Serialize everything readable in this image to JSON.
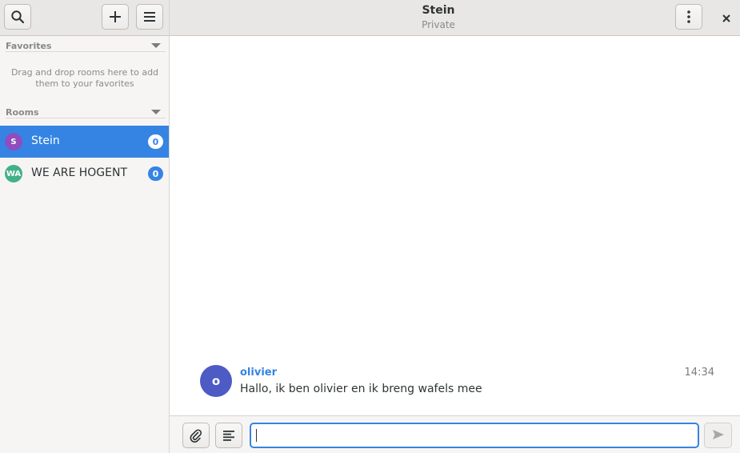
{
  "sidebar": {
    "favorites": {
      "label": "Favorites",
      "hint": "Drag and drop rooms here to add them to your favorites"
    },
    "rooms_section": {
      "label": "Rooms"
    },
    "rooms": [
      {
        "initials": "S",
        "name": "Stein",
        "count": "0",
        "avatar_color": "#8f4dc0",
        "selected": true
      },
      {
        "initials": "WA",
        "name": "WE ARE HOGENT",
        "count": "0",
        "avatar_color": "#43b089",
        "selected": false
      }
    ]
  },
  "header": {
    "title": "Stein",
    "subtitle": "Private"
  },
  "messages": [
    {
      "initial": "o",
      "sender": "olivier",
      "time": "14:34",
      "body": "Hallo, ik ben olivier en ik breng wafels mee"
    }
  ],
  "composer": {
    "value": ""
  },
  "colors": {
    "accent": "#3584e4",
    "header_bg": "#e9e7e5",
    "sidebar_bg": "#f6f5f4"
  },
  "icons": {
    "search": "search-icon",
    "add": "plus-icon",
    "menu": "hamburger-icon",
    "room_menu": "vertical-dots-icon",
    "close": "close-icon",
    "attach": "paperclip-icon",
    "markdown": "text-format-icon",
    "send": "send-icon"
  }
}
